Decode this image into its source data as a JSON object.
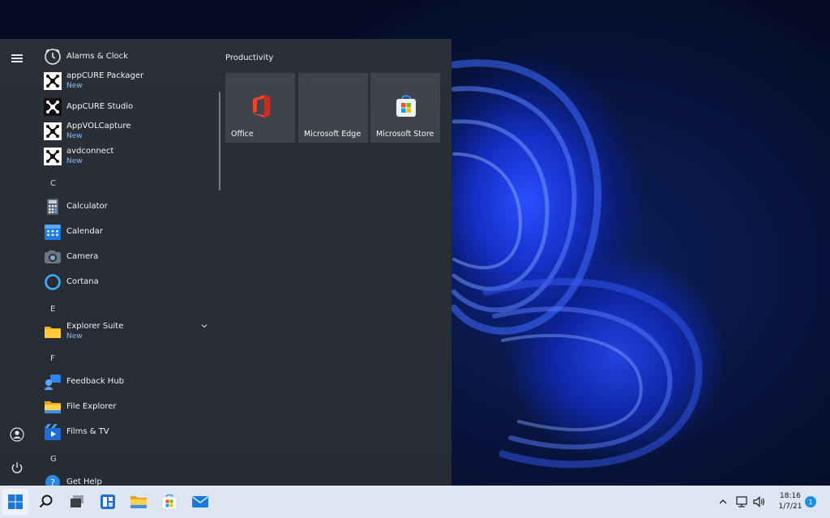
{
  "start_menu": {
    "apps": [
      {
        "name": "Alarms & Clock",
        "new": "",
        "icon": "alarm-clock-icon"
      },
      {
        "name": "appCURE Packager",
        "new": "New",
        "icon": "appcure-icon"
      },
      {
        "name": "AppCURE Studio",
        "new": "",
        "icon": "appcure-icon"
      },
      {
        "name": "AppVOLCapture",
        "new": "New",
        "icon": "appcure-icon"
      },
      {
        "name": "avdconnect",
        "new": "New",
        "icon": "appcure-icon"
      },
      {
        "name": "Calculator",
        "new": "",
        "icon": "calculator-icon"
      },
      {
        "name": "Calendar",
        "new": "",
        "icon": "calendar-icon"
      },
      {
        "name": "Camera",
        "new": "",
        "icon": "camera-icon"
      },
      {
        "name": "Cortana",
        "new": "",
        "icon": "cortana-icon"
      },
      {
        "name": "Explorer Suite",
        "new": "New",
        "icon": "folder-icon"
      },
      {
        "name": "Feedback Hub",
        "new": "",
        "icon": "feedback-hub-icon"
      },
      {
        "name": "File Explorer",
        "new": "",
        "icon": "file-explorer-icon"
      },
      {
        "name": "Films & TV",
        "new": "",
        "icon": "films-tv-icon"
      },
      {
        "name": "Get Help",
        "new": "",
        "icon": "get-help-icon"
      }
    ],
    "letters": [
      "C",
      "E",
      "F",
      "G"
    ],
    "tile_group": {
      "title": "Productivity",
      "tiles": [
        {
          "label": "Office",
          "icon": "office-icon"
        },
        {
          "label": "Microsoft Edge",
          "icon": ""
        },
        {
          "label": "Microsoft Store",
          "icon": "store-icon"
        }
      ]
    }
  },
  "taskbar": {
    "clock_time": "18:16",
    "clock_date": "1/7/21",
    "notification_count": "1"
  }
}
